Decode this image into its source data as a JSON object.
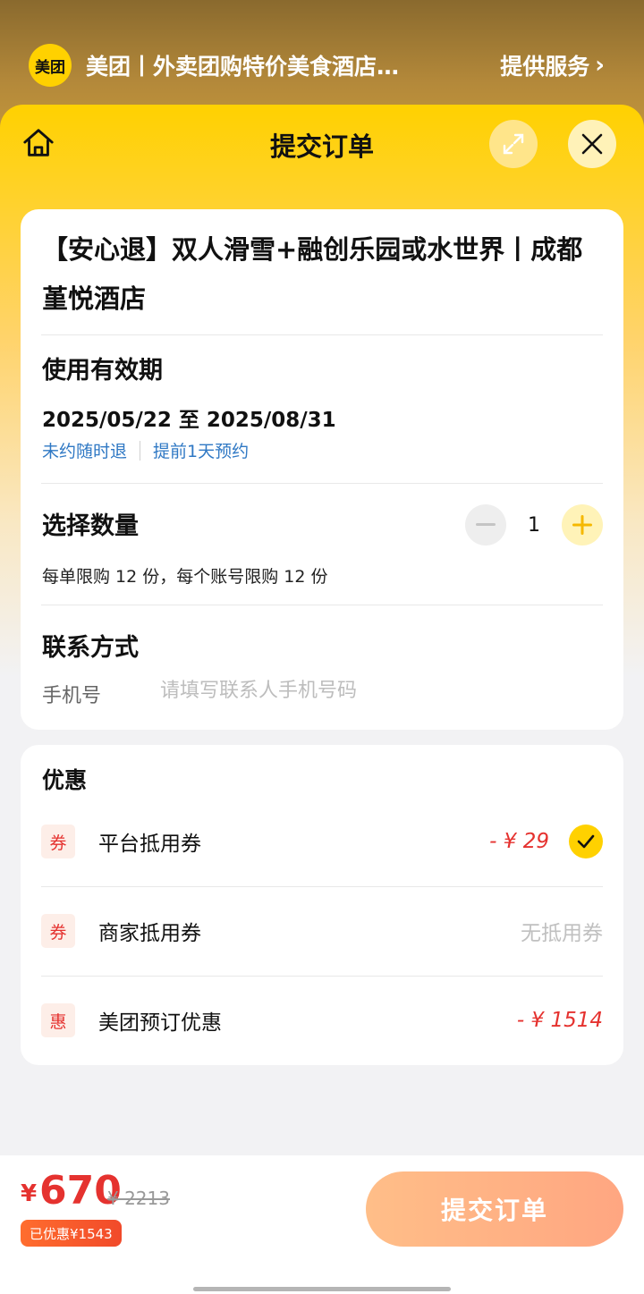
{
  "topbar": {
    "logo": "美团",
    "title": "美团丨外卖团购特价美食酒店…",
    "right_label": "提供服务",
    "chevron": "›"
  },
  "header": {
    "title": "提交订单",
    "icons": [
      "home-icon",
      "expand-icon",
      "close-icon"
    ]
  },
  "product": {
    "title": "【安心退】双人滑雪+融创乐园或水世界丨成都堇悦酒店"
  },
  "validity": {
    "label": "使用有效期",
    "dates": "2025/05/22 至 2025/08/31",
    "tags": [
      "未约随时退",
      "提前1天预约"
    ]
  },
  "quantity": {
    "label": "选择数量",
    "value": "1",
    "limit": "每单限购 12 份，每个账号限购 12 份"
  },
  "contact": {
    "label": "联系方式",
    "phone_label": "手机号",
    "phone_placeholder": "请填写联系人手机号码",
    "phone_value": ""
  },
  "discounts": {
    "title": "优惠",
    "items": [
      {
        "badge": "券",
        "label": "平台抵用券",
        "value": "- ¥ 29",
        "checked": true
      },
      {
        "badge": "券",
        "label": "商家抵用券",
        "value": "无抵用券"
      },
      {
        "badge": "惠",
        "label": "美团预订优惠",
        "value": "- ¥ 1514"
      }
    ]
  },
  "footer": {
    "currency": "¥",
    "price": "670",
    "original_price": "¥ 2213",
    "saved": "已优惠¥1543",
    "submit_label": "提交订单"
  },
  "colors": {
    "brand_yellow": "#ffd100",
    "price_red": "#e5322f",
    "link_blue": "#2f78c4",
    "submit_orange": "#ffab84"
  }
}
